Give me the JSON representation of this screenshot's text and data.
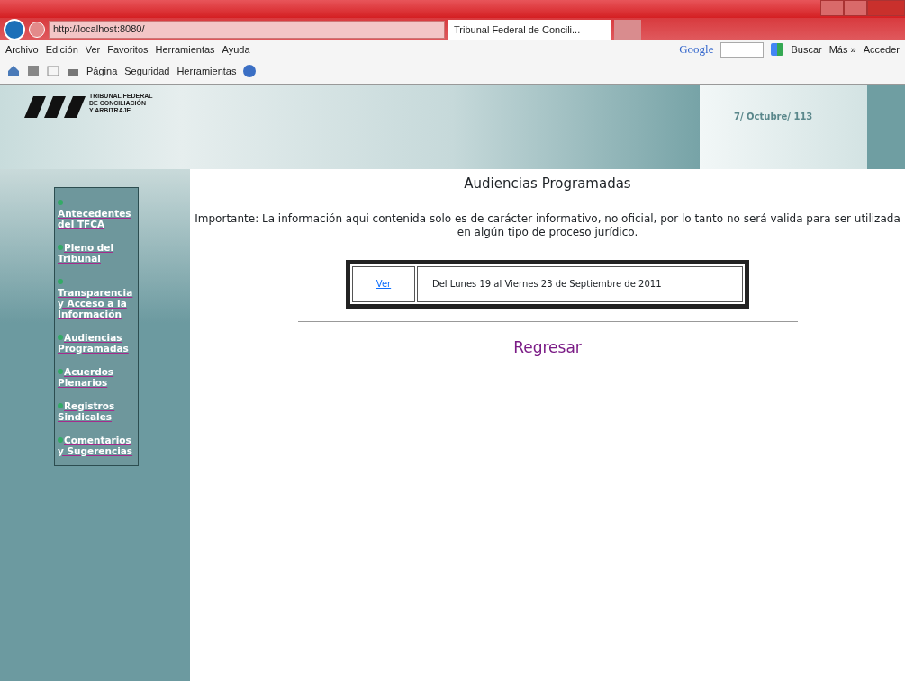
{
  "browser": {
    "address": "http://localhost:8080/",
    "tab_title": "Tribunal Federal de Concili...",
    "menu": [
      "Archivo",
      "Edición",
      "Ver",
      "Favoritos",
      "Herramientas",
      "Ayuda"
    ],
    "command_bar": [
      "Página",
      "Seguridad",
      "Herramientas"
    ],
    "google": {
      "logo": "Google",
      "search_button": "Buscar",
      "more": "Más »",
      "sign_in": "Acceder"
    }
  },
  "header": {
    "logo_lines": [
      "TRIBUNAL FEDERAL",
      "DE CONCILIACIÓN",
      "Y ARBITRAJE"
    ],
    "date": "7/ Octubre/ 113"
  },
  "sidebar": {
    "items": [
      {
        "label": "Antecedentes del TFCA"
      },
      {
        "label": "Pleno del Tribunal"
      },
      {
        "label": "Transparencia y Acceso a la Información"
      },
      {
        "label": "Audiencias Programadas"
      },
      {
        "label": "Acuerdos Plenarios"
      },
      {
        "label": "Registros Sindicales"
      },
      {
        "label": "Comentarios y Sugerencias"
      }
    ]
  },
  "content": {
    "title": "Audiencias Programadas",
    "notice": "Importante: La información aqui contenida solo es de carácter informativo, no oficial, por lo tanto no será valida para ser utilizada en algún tipo de proceso jurídico.",
    "schedule": [
      {
        "link": "Ver",
        "period": "Del Lunes 19 al Viernes 23 de Septiembre de 2011"
      }
    ],
    "back_link": "Regresar"
  }
}
